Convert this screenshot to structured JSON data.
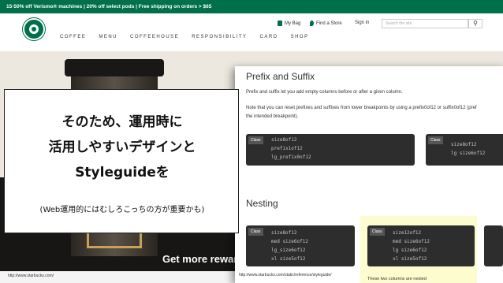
{
  "promo": "15-50% off Verismo® machines | 20% off select pods | Free shipping on orders > $65",
  "util": {
    "bag": "My Bag",
    "store": "Find a Store",
    "signin": "Sign in",
    "search_placeholder": "Search the site"
  },
  "nav": [
    "COFFEE",
    "MENU",
    "COFFEEHOUSE",
    "RESPONSIBILITY",
    "CARD",
    "SHOP"
  ],
  "reward": "Get more reward",
  "bg_url": "http://www.starbucks.com/",
  "doc": {
    "h1": "Prefix and Suffix",
    "p1": "Prefix and suffix let you add empty columns before or after a given column.",
    "p2": "Note that you can reset prefixes and suffixes from lower breakpoints by using a prefix0of12 or suffix0of12 (pref",
    "p3": "the intended breakpoint).",
    "tag": "Class",
    "block1": [
      "size8of12",
      "prefix1of12",
      "lg_prefix0of12"
    ],
    "block2": [
      "size8of12",
      "lg size6of12"
    ],
    "h2": "Nesting",
    "block3": [
      "size8of12",
      "med size6of12",
      "lg_size6of12",
      "xl size5of12"
    ],
    "block4": [
      "size12of12",
      "med size6of12",
      "lg size6of12",
      "xl size5of12"
    ],
    "note": "These two columns are nested",
    "url": "http://www.starbucks.com/static/reference/styleguide/"
  },
  "callout": {
    "l1": "そのため、運用時に",
    "l2": "活用しやすいデザインと",
    "l3": "Styleguideを",
    "sub": "(Web運用的にはむしろこっちの方が重要かも)"
  }
}
